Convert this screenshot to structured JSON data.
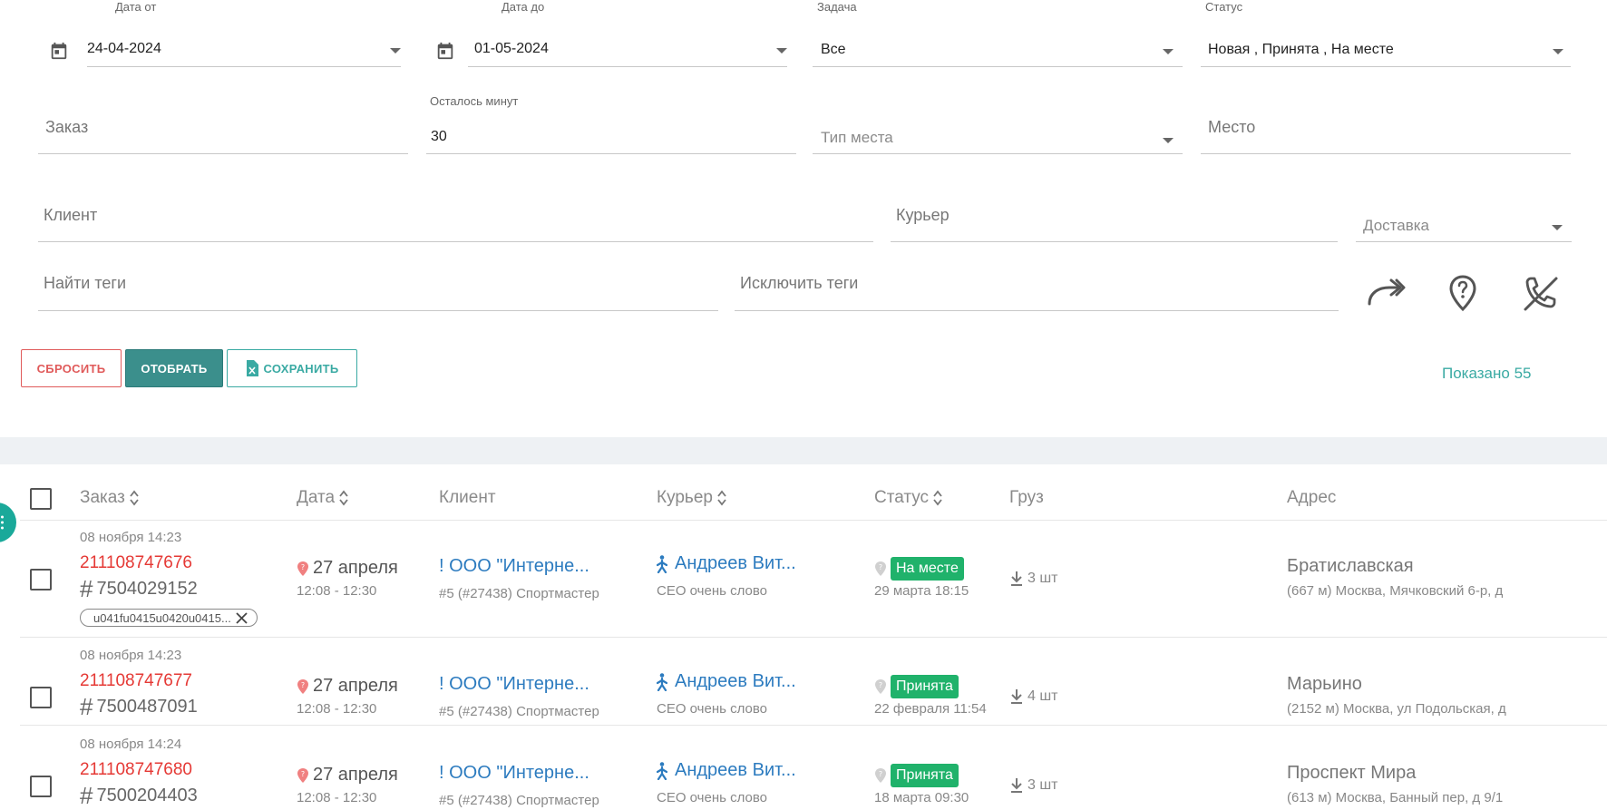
{
  "filters": {
    "date_from": {
      "label": "Дата от",
      "value": "24-04-2024"
    },
    "date_to": {
      "label": "Дата до",
      "value": "01-05-2024"
    },
    "task": {
      "label": "Задача",
      "value": "Все"
    },
    "status": {
      "label": "Статус",
      "value": "Новая , Принята , На месте"
    },
    "order": {
      "placeholder": "Заказ"
    },
    "minutes_left": {
      "label": "Осталось минут",
      "value": "30"
    },
    "place_type": {
      "placeholder": "Тип места"
    },
    "place": {
      "placeholder": "Место"
    },
    "client": {
      "placeholder": "Клиент"
    },
    "courier": {
      "placeholder": "Курьер"
    },
    "delivery": {
      "placeholder": "Доставка"
    },
    "find_tags": {
      "placeholder": "Найти теги"
    },
    "exclude_tags": {
      "placeholder": "Исключить теги"
    }
  },
  "actions": {
    "reset_label": "СБРОСИТЬ",
    "apply_label": "ОТОБРАТЬ",
    "save_label": "СОХРАНИТЬ",
    "shown_text": "Показано 55"
  },
  "tool_icons": [
    "forward-arrow-icon",
    "location-question-icon",
    "phone-off-icon"
  ],
  "table": {
    "headers": {
      "order": "Заказ",
      "date": "Дата",
      "client": "Клиент",
      "courier": "Курьер",
      "status": "Статус",
      "cargo": "Груз",
      "address": "Адрес"
    },
    "rows": [
      {
        "created": "08 ноября 14:23",
        "order_num": "211108747676",
        "hash_num": "7504029152",
        "tag": "u041fu0415u0420u0415...",
        "date_main": "27 апреля",
        "date_sub": "12:08 - 12:30",
        "client_main": "! ООО \"Интерне...",
        "client_sub": "#5 (#27438) Спортмастер",
        "courier_main": "Андреев Вит...",
        "courier_sub": "CEO очень слово",
        "status": "На месте",
        "status_color": "#20b26b",
        "status_sub": "29 марта 18:15",
        "cargo": "3 шт",
        "addr_main": "Братиславская",
        "addr_sub": "(667 м) Москва, Мячковский 6-р, д"
      },
      {
        "created": "08 ноября 14:23",
        "order_num": "211108747677",
        "hash_num": "7500487091",
        "date_main": "27 апреля",
        "date_sub": "12:08 - 12:30",
        "client_main": "! ООО \"Интерне...",
        "client_sub": "#5 (#27438) Спортмастер",
        "courier_main": "Андреев Вит...",
        "courier_sub": "CEO очень слово",
        "status": "Принята",
        "status_color": "#20b26b",
        "status_sub": "22 февраля 11:54",
        "cargo": "4 шт",
        "addr_main": "Марьино",
        "addr_sub": "(2152 м) Москва, ул Подольская, д"
      },
      {
        "created": "08 ноября 14:24",
        "order_num": "211108747680",
        "hash_num": "7500204403",
        "date_main": "27 апреля",
        "date_sub": "12:08 - 12:30",
        "client_main": "! ООО \"Интерне...",
        "client_sub": "#5 (#27438) Спортмастер",
        "courier_main": "Андреев Вит...",
        "courier_sub": "CEO очень слово",
        "status": "Принята",
        "status_color": "#20b26b",
        "status_sub": "18 марта 09:30",
        "cargo": "3 шт",
        "addr_main": "Проспект Мира",
        "addr_sub": "(613 м) Москва, Банный пер, д 9/1"
      }
    ]
  },
  "colors": {
    "accent": "#3aaaa3",
    "danger": "#e05a5a",
    "link": "#2c7bbf",
    "order_red": "#e53935",
    "status_green": "#20b26b"
  }
}
